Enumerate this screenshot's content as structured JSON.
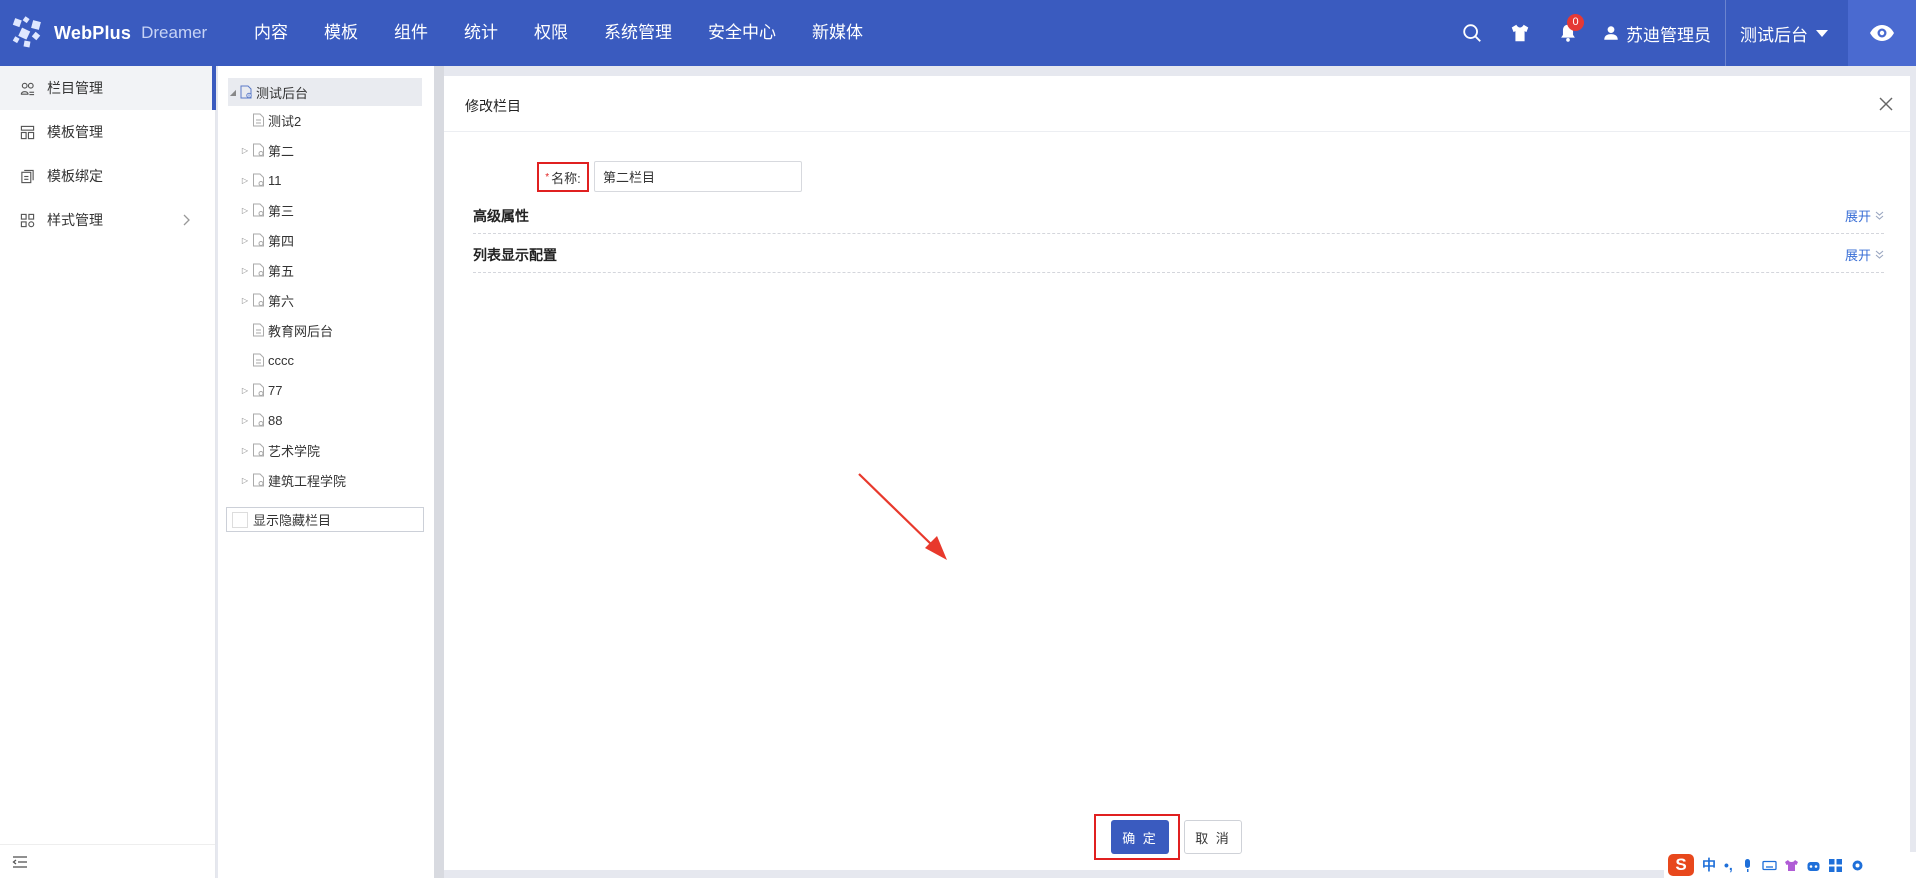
{
  "app": {
    "logo_text": "WebPlus",
    "logo_sub": "Dreamer"
  },
  "topnav": {
    "items": [
      "内容",
      "模板",
      "组件",
      "统计",
      "权限",
      "系统管理",
      "安全中心",
      "新媒体"
    ]
  },
  "header": {
    "notification_count": "0",
    "user_name": "苏迪管理员",
    "site_name": "测试后台"
  },
  "sidebar": {
    "items": [
      {
        "label": "栏目管理",
        "icon": "columns-icon",
        "active": true
      },
      {
        "label": "模板管理",
        "icon": "template-icon"
      },
      {
        "label": "模板绑定",
        "icon": "bind-icon"
      },
      {
        "label": "样式管理",
        "icon": "style-icon",
        "has_children": true
      }
    ]
  },
  "tree": {
    "root": "测试后台",
    "children": [
      "测试2",
      "第二",
      "11",
      "第三",
      "第四",
      "第五",
      "第六",
      "教育网后台",
      "cccc",
      "77",
      "88",
      "艺术学院",
      "建筑工程学院"
    ],
    "show_hidden_label": "显示隐藏栏目"
  },
  "dialog": {
    "title": "修改栏目",
    "name_label": "名称:",
    "name_required_mark": "*",
    "name_value": "第二栏目",
    "sections": [
      {
        "title": "高级属性",
        "expand": "展开"
      },
      {
        "title": "列表显示配置",
        "expand": "展开"
      }
    ],
    "confirm_label": "确 定",
    "cancel_label": "取 消"
  },
  "ime": {
    "logo": "S",
    "lang": "中",
    "punct": "•,"
  },
  "colors": {
    "primary": "#3a5bbf",
    "annotation_red": "#e02020",
    "link_blue": "#3a6fd6"
  }
}
